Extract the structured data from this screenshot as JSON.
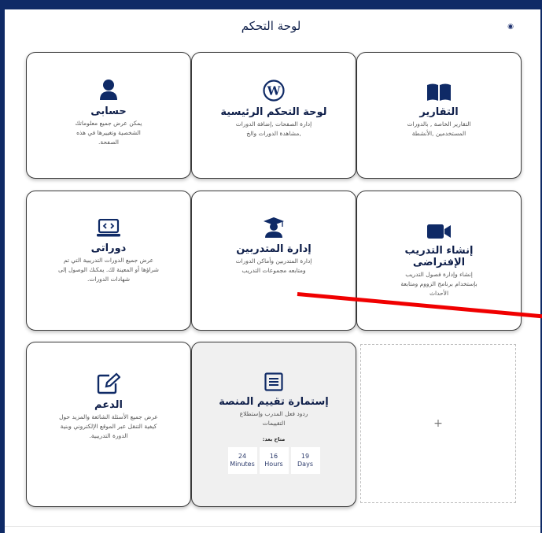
{
  "page": {
    "title": "لوحة التحكم"
  },
  "cards": {
    "reports": {
      "title": "التقارير",
      "desc": "التقارير الخاصة , بالدورات المستخدمين ,الأنشطة",
      "icon": "book-open-icon"
    },
    "dashboard": {
      "title": "لوحة التحكم الرئيسية",
      "desc": "إدارة الصفحات ,إضافة الدورات ,مشاهدة الدورات والخ",
      "icon": "wordpress-icon"
    },
    "account": {
      "title": "حسابى",
      "desc": "يمكن عرض جميع معلوماتك الشخصية وتغييرها في هذه الصفحة.",
      "icon": "user-icon"
    },
    "virtual_training": {
      "title": "إنشاء التدريب الإفتراضى",
      "desc": "إنشاء وإدارة فصول التدريب بإستخدام برنامج الزووم ومتابعة الأحداث",
      "icon": "video-camera-icon"
    },
    "trainees": {
      "title": "إدارة المتدربين",
      "desc": "إدارة المتدربين وأماكن الدورات ومتابعه مجموعات التدريب",
      "icon": "graduate-icon"
    },
    "my_courses": {
      "title": "دوراتى",
      "desc": "عرض جميع الدورات التدريبية التي تم شراؤها أو المعينة لك. يمكنك الوصول إلى شهادات الدورات.",
      "icon": "laptop-code-icon"
    },
    "evaluation": {
      "title": "إستمارة تقييم المنصة",
      "desc": "ردود فعل المدرب وإستطلاع التقييمات",
      "icon": "form-icon",
      "available_label": "متاح بعد:",
      "countdown": [
        {
          "value": "24",
          "unit": "Minutes"
        },
        {
          "value": "16",
          "unit": "Hours"
        },
        {
          "value": "19",
          "unit": "Days"
        }
      ]
    },
    "support": {
      "title": "الدعم",
      "desc": "عرض جميع الأسئلة الشائعة والمزيد حول كيفية التنقل عبر الموقع الإلكتروني وبنية الدورة التدريبية.",
      "icon": "edit-icon"
    }
  },
  "empty_slot": {
    "symbol": "+"
  },
  "colors": {
    "frame": "#0f2a66",
    "icon": "#0f2a66",
    "annotation": "#f00000"
  }
}
